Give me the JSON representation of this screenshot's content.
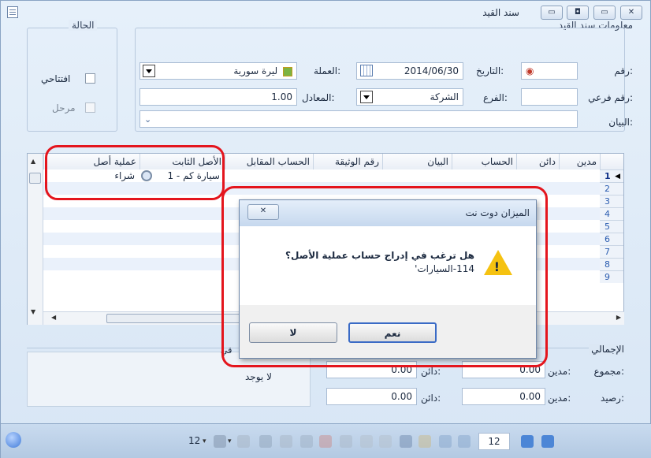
{
  "window": {
    "title": "سند القيد"
  },
  "info": {
    "section_label": "معلومات سند القيد",
    "number_label": "رقم:",
    "sub_number_label": "رقم فرعي:",
    "date_label": "التاريخ:",
    "date_value": "2014/06/30",
    "currency_label": "العملة:",
    "currency_value": "ليرة سورية",
    "branch_label": "الفرع:",
    "branch_value": "الشركة",
    "rate_label": "المعادل:",
    "rate_value": "1.00",
    "statement_label": "البيان:"
  },
  "status": {
    "label": "الحالة",
    "opening": "افتتاحي",
    "posted": "مرحل"
  },
  "grid": {
    "headers": [
      "مدين",
      "دائن",
      "الحساب",
      "البيان",
      "رقم الوثيقة",
      "الحساب المقابل",
      "الأصل الثابت",
      "عملية أصل"
    ],
    "row1_asset": "1 - سيارة كم",
    "row1_operation": "شراء",
    "row_numbers": [
      "1",
      "2",
      "3",
      "4",
      "5",
      "6",
      "7",
      "8",
      "9"
    ]
  },
  "totals": {
    "label": "الإجمالي",
    "sum_label": "مجموع:",
    "balance_label": "رصيد:",
    "debit_label": "مدين:",
    "credit_label": "دائن:",
    "sum_debit": "0.00",
    "sum_credit": "0.00",
    "bal_debit": "0.00",
    "bal_credit": "0.00",
    "none_text": "لا يوجد",
    "partial_label": "قي"
  },
  "toolbar": {
    "left_count": "12",
    "page_value": "12"
  },
  "dialog": {
    "title": "الميزان دوت نت",
    "message_line1": "هل ترغب في إدراج حساب عملية الأصل؟",
    "message_line2": "114-السيارات'",
    "yes_label": "نعم",
    "no_label": "لا"
  },
  "colors": {
    "highlight": "#e4151d",
    "accent": "#2a5cb0"
  }
}
